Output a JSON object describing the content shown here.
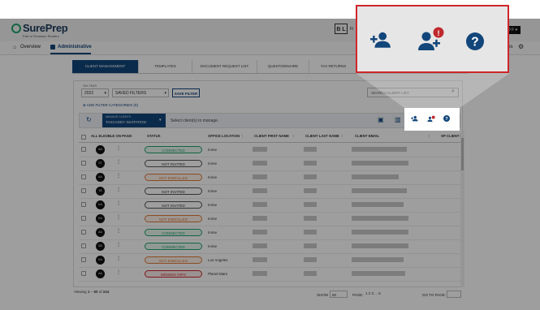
{
  "app": {
    "brand": "SurePrep",
    "brand_sub": "Part of Thomson Reuters",
    "bl_badge": "B L",
    "bl_after": "Fi",
    "user_btn": "O F ▾",
    "settings_text": "les"
  },
  "nav": {
    "overview": "Overview",
    "administrative": "Administrative"
  },
  "tabs": [
    "CLIENT MANAGEMENT",
    "TEMPLATES",
    "DOCUMENT REQUEST LIST",
    "QUESTIONNAIRE",
    "TAX RETURNS"
  ],
  "filters": {
    "tax_year_label": "TAX YEAR",
    "tax_year_value": "2022",
    "saved_filters": "SAVED FILTERS",
    "save_filter": "SAVE FILTER",
    "search_placeholder": "SEARCH CLIENT LIST",
    "add_filter": "ADD FILTER CATEGORIES",
    "add_filter_count": "(0)"
  },
  "manage": {
    "label": "MANAGE CLIENTS",
    "value": "TAXCADDY INVITATION",
    "hint": "Select client(s) to manage."
  },
  "table": {
    "headers": [
      "ALL ELIGIBLE ON PAGE",
      "STATUS",
      "OFFICE LOCATION",
      "CLIENT FIRST NAME",
      "CLIENT LAST NAME",
      "CLIENT EMAIL",
      "SP CLIENT ID"
    ],
    "rows": [
      {
        "initials": "AA",
        "status": "CONNECTED",
        "kind": "connected",
        "office": "Irvine"
      },
      {
        "initials": "ST",
        "status": "NOT INVITED",
        "kind": "not-invited",
        "office": "Irvine"
      },
      {
        "initials": "AA",
        "status": "NOT ENROLLED",
        "kind": "not-enrolled",
        "office": "Irvine"
      },
      {
        "initials": "TA",
        "status": "NOT INVITED",
        "kind": "not-invited",
        "office": "Irvine"
      },
      {
        "initials": "KA",
        "status": "NOT INVITED",
        "kind": "not-invited",
        "office": "Irvine"
      },
      {
        "initials": "KA",
        "status": "NOT ENROLLED",
        "kind": "not-enrolled",
        "office": "Irvine"
      },
      {
        "initials": "AA",
        "status": "CONNECTED",
        "kind": "connected",
        "office": "Irvine"
      },
      {
        "initials": "SA",
        "status": "CONNECTED",
        "kind": "connected",
        "office": "Irvine"
      },
      {
        "initials": "KA",
        "status": "NOT ENROLLED",
        "kind": "not-enrolled",
        "office": "Los Angeles"
      },
      {
        "initials": "AA",
        "status": "MISSING INFO",
        "kind": "missing",
        "office": "Planet Mars"
      }
    ]
  },
  "footer": {
    "viewing_prefix": "Viewing",
    "viewing_from": "1",
    "viewing_to": "50",
    "viewing_of": "of",
    "viewing_total": "244",
    "show_label": "SHOW",
    "show_value": "50",
    "page_label": "PAGE:",
    "pages": "1  2  3  ...  5",
    "goto_label": "GO TO PAGE:"
  },
  "colors": {
    "brand": "#12467b",
    "highlight_border": "#d0262a",
    "connected": "#1fa46b",
    "not_enrolled": "#e07b39",
    "missing": "#d0262a",
    "badge": "#c0282d"
  },
  "icons": {
    "add_user": "add-user-icon",
    "manage_users_alert": "users-alert-icon",
    "help": "help-icon"
  }
}
